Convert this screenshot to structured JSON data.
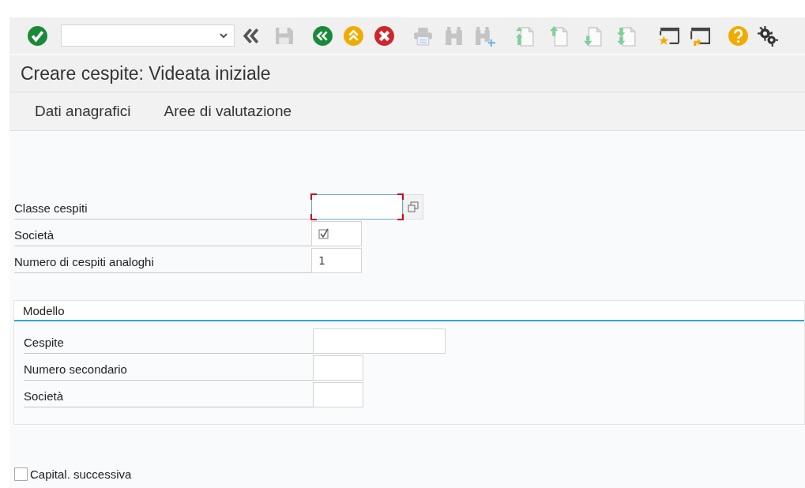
{
  "toolbar": {
    "items": [
      {
        "kind": "enter",
        "disabled": false
      },
      {
        "kind": "command"
      },
      {
        "kind": "collapse",
        "disabled": false
      },
      {
        "kind": "save",
        "disabled": true
      },
      {
        "kind": "back",
        "disabled": false
      },
      {
        "kind": "exit",
        "disabled": false
      },
      {
        "kind": "cancel",
        "disabled": false
      },
      {
        "kind": "print",
        "disabled": true
      },
      {
        "kind": "find",
        "disabled": true
      },
      {
        "kind": "find_next",
        "disabled": true
      },
      {
        "kind": "first_page",
        "disabled": true
      },
      {
        "kind": "prev_page",
        "disabled": true
      },
      {
        "kind": "next_page",
        "disabled": true
      },
      {
        "kind": "last_page",
        "disabled": true
      },
      {
        "kind": "new_session",
        "disabled": false
      },
      {
        "kind": "shortcut",
        "disabled": false
      },
      {
        "kind": "help",
        "disabled": false
      },
      {
        "kind": "settings",
        "disabled": false
      }
    ]
  },
  "window": {
    "title": "Creare cespite: Videata iniziale"
  },
  "menu": [
    {
      "label": "Dati anagrafici"
    },
    {
      "label": "Aree di valutazione"
    }
  ],
  "fields": [
    {
      "label": "Classe cespiti",
      "kind": "search",
      "focused": true
    },
    {
      "label": "Società",
      "kind": "required"
    },
    {
      "label": "Numero di cespiti analoghi",
      "kind": "short",
      "value": "1"
    }
  ],
  "group": {
    "title": "Modello",
    "fields": [
      {
        "label": "Cespite",
        "kind": "long"
      },
      {
        "label": "Numero secondario",
        "kind": "short"
      },
      {
        "label": "Società",
        "kind": "short"
      }
    ]
  },
  "options": [
    {
      "label": "Capital. successiva",
      "checked": false
    }
  ]
}
